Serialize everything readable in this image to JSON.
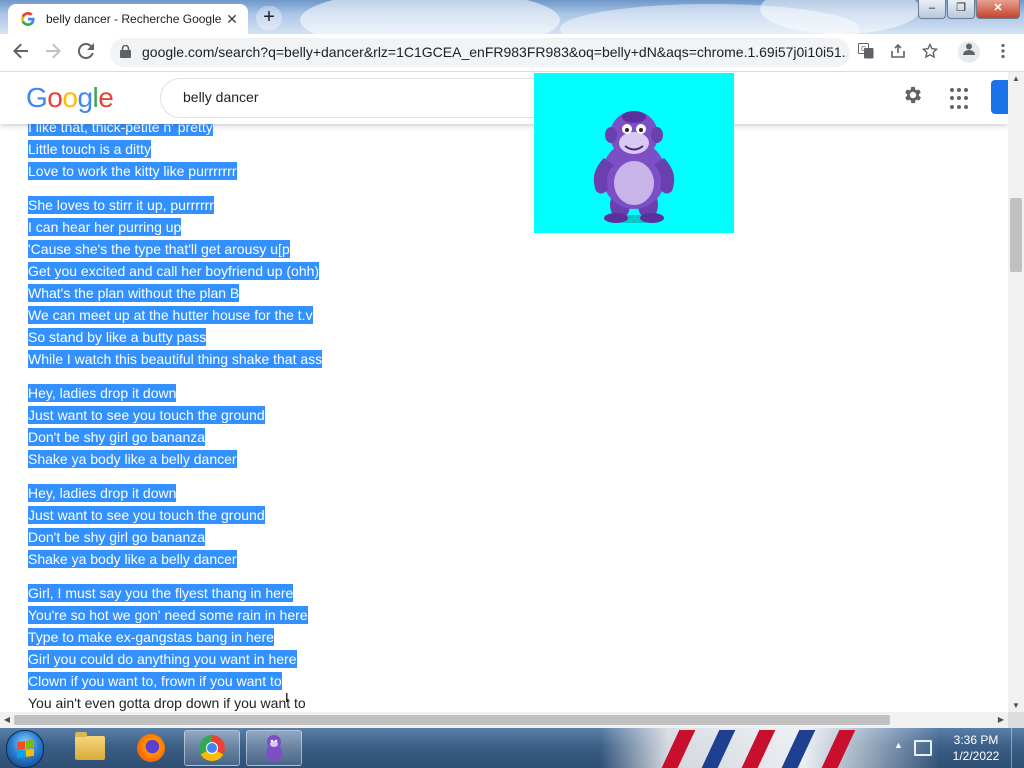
{
  "browser": {
    "tab_title": "belly dancer - Recherche Google",
    "tab_close": "✕",
    "new_tab": "+",
    "url": "google.com/search?q=belly+dancer&rlz=1C1GCEA_enFR983FR983&oq=belly+dN&aqs=chrome.1.69i57j0i10i51...",
    "window_buttons": {
      "minimize": "–",
      "restore": "❐",
      "close": "✕"
    }
  },
  "google": {
    "logo": [
      "G",
      "o",
      "o",
      "g",
      "l",
      "e"
    ],
    "search_value": "belly dancer"
  },
  "lyrics": [
    [
      "I like that, thick-petite n' pretty",
      "Little touch is a ditty",
      "Love to work the kitty like purrrrrrr"
    ],
    [
      "She loves to stirr it up, purrrrrr",
      "I can hear her purring up",
      "'Cause she's the type that'll get arousy u[p",
      "Get you excited and call her boyfriend up (ohh)",
      "What's the plan without the plan B",
      "We can meet up at the hutter house for the t.v",
      "So stand by like a butty pass",
      "While I watch this beautiful thing shake that ass"
    ],
    [
      "Hey, ladies drop it down",
      "Just want to see you touch the ground",
      "Don't be shy girl go bananza",
      "Shake ya body like a belly dancer"
    ],
    [
      "Hey, ladies drop it down",
      "Just want to see you touch the ground",
      "Don't be shy girl go bananza",
      "Shake ya body like a belly dancer"
    ],
    [
      "Girl, I must say you the flyest thang in here",
      "You're so hot we gon' need some rain in here",
      "Type to make ex-gangstas bang in here",
      "Girl you could do anything you want in here",
      "Clown if you want to, frown if you want to"
    ]
  ],
  "unselected_line": "You ain't even gotta drop down if you want to",
  "taskbar": {
    "time": "3:36 PM",
    "date": "1/2/2022",
    "tray_arrow": "▲"
  },
  "colors": {
    "selection": "#3390ff",
    "image_background": "#00ffff",
    "google_blue": "#4285f4"
  },
  "icons": {
    "back": "back-arrow-icon",
    "forward": "forward-arrow-icon",
    "reload": "reload-icon",
    "lock": "lock-icon",
    "translate": "translate-icon",
    "share": "share-icon",
    "bookmark": "star-icon",
    "settings": "gear-icon",
    "apps": "apps-grid-icon",
    "menu": "kebab-menu-icon"
  }
}
